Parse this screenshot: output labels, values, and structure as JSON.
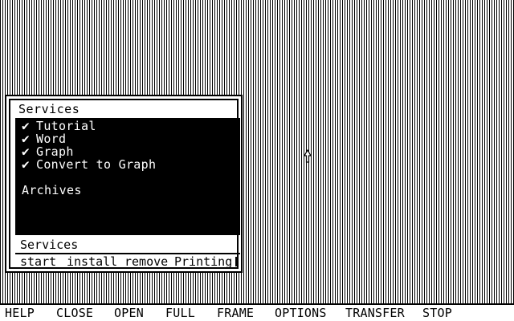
{
  "window": {
    "title": "Services",
    "items": [
      {
        "label": "Tutorial",
        "checked": true,
        "check_glyph": "✔"
      },
      {
        "label": "Word",
        "checked": true,
        "check_glyph": "✔"
      },
      {
        "label": "Graph",
        "checked": true,
        "check_glyph": "✔"
      },
      {
        "label": "Convert to Graph",
        "checked": true,
        "check_glyph": "✔"
      },
      {
        "label": "Archives",
        "checked": false,
        "check_glyph": ""
      }
    ],
    "footer_title": "Services",
    "actions": [
      "start",
      "install",
      "remove",
      "Printing"
    ]
  },
  "menubar": {
    "items": [
      "HELP",
      "CLOSE",
      "OPEN",
      "FULL",
      "FRAME",
      "OPTIONS",
      "TRANSFER",
      "STOP"
    ]
  },
  "icons": {
    "cursor": "arrow-cursor-icon",
    "check": "checkmark-icon"
  },
  "colors": {
    "foreground": "#000000",
    "background": "#ffffff"
  }
}
